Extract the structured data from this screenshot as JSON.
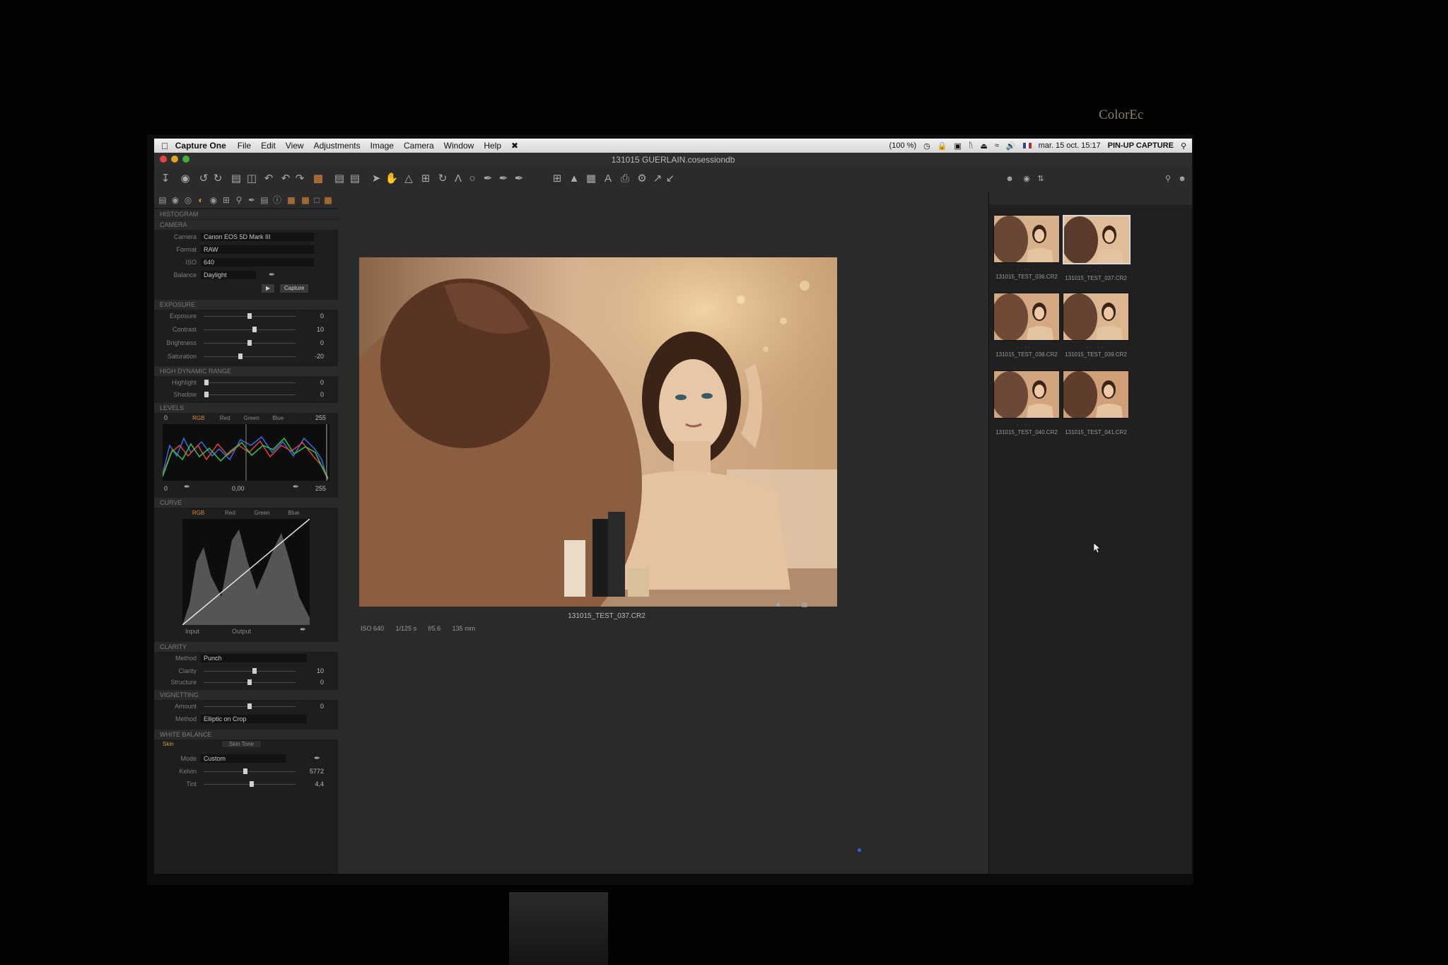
{
  "bezel": {
    "brand": "ColorEc"
  },
  "menubar": {
    "app": "Capture One",
    "items": [
      "File",
      "Edit",
      "View",
      "Adjustments",
      "Image",
      "Camera",
      "Window",
      "Help"
    ],
    "status": {
      "zoom": "(100 %)",
      "datetime": "mar. 15 oct. 15:17",
      "user": "PIN-UP CAPTURE"
    }
  },
  "window": {
    "title": "131015 GUERLAIN.cosessiondb"
  },
  "left_panel": {
    "sections": {
      "histogram": "HISTOGRAM",
      "camera": "CAMERA",
      "exposure": "EXPOSURE",
      "hdr": "HIGH DYNAMIC RANGE",
      "levels": "LEVELS",
      "curve": "CURVE",
      "clarity": "CLARITY",
      "vignetting": "VIGNETTING",
      "white_balance": "WHITE BALANCE"
    },
    "camera": {
      "camera_label": "Camera",
      "camera_value": "Canon EOS 5D Mark III",
      "format_label": "Format",
      "format_value": "RAW",
      "iso_label": "ISO",
      "iso_value": "640",
      "balance_label": "Balance",
      "balance_value": "Daylight",
      "capture_button": "Capture"
    },
    "exposure": [
      {
        "label": "Exposure",
        "value": "0",
        "pos": 0.5
      },
      {
        "label": "Contrast",
        "value": "10",
        "pos": 0.55
      },
      {
        "label": "Brightness",
        "value": "0",
        "pos": 0.5
      },
      {
        "label": "Saturation",
        "value": "-20",
        "pos": 0.4
      }
    ],
    "hdr": [
      {
        "label": "Highlight",
        "value": "0",
        "pos": 0.03
      },
      {
        "label": "Shadow",
        "value": "0",
        "pos": 0.03
      }
    ],
    "levels": {
      "low": "0",
      "high": "255",
      "mid": "0,00",
      "out_low": "0",
      "out_high": "255",
      "channels": [
        "RGB",
        "Red",
        "Green",
        "Blue"
      ]
    },
    "curve": {
      "channels": [
        "RGB",
        "Red",
        "Green",
        "Blue"
      ],
      "input": "Input",
      "output": "Output"
    },
    "clarity": {
      "method_label": "Method",
      "method_value": "Punch",
      "rows": [
        {
          "label": "Clarity",
          "value": "10",
          "pos": 0.55
        },
        {
          "label": "Structure",
          "value": "0",
          "pos": 0.5
        }
      ]
    },
    "vignetting": {
      "amount_label": "Amount",
      "amount_value": "0",
      "amount_pos": 0.5,
      "method_label": "Method",
      "method_value": "Elliptic on Crop"
    },
    "white_balance": {
      "tab_skin": "Skin",
      "tab_color": "Skin Tone",
      "mode_label": "Mode",
      "mode_value": "Custom",
      "kelvin_label": "Kelvin",
      "kelvin_value": "5772",
      "kelvin_pos": 0.45,
      "tint_label": "Tint",
      "tint_value": "4,4",
      "tint_pos": 0.52
    }
  },
  "viewer": {
    "filename": "131015_TEST_037.CR2",
    "meta": [
      "ISO 640",
      "1/125 s",
      "f/5.6",
      "135 mm"
    ]
  },
  "browser": {
    "thumbnails": [
      {
        "name": "131015_TEST_036.CR2",
        "selected": false
      },
      {
        "name": "131015_TEST_037.CR2",
        "selected": true
      },
      {
        "name": "131015_TEST_038.CR2",
        "selected": false
      },
      {
        "name": "131015_TEST_039.CR2",
        "selected": false
      },
      {
        "name": "131015_TEST_040.CR2",
        "selected": false
      },
      {
        "name": "131015_TEST_041.CR2",
        "selected": false
      }
    ]
  }
}
